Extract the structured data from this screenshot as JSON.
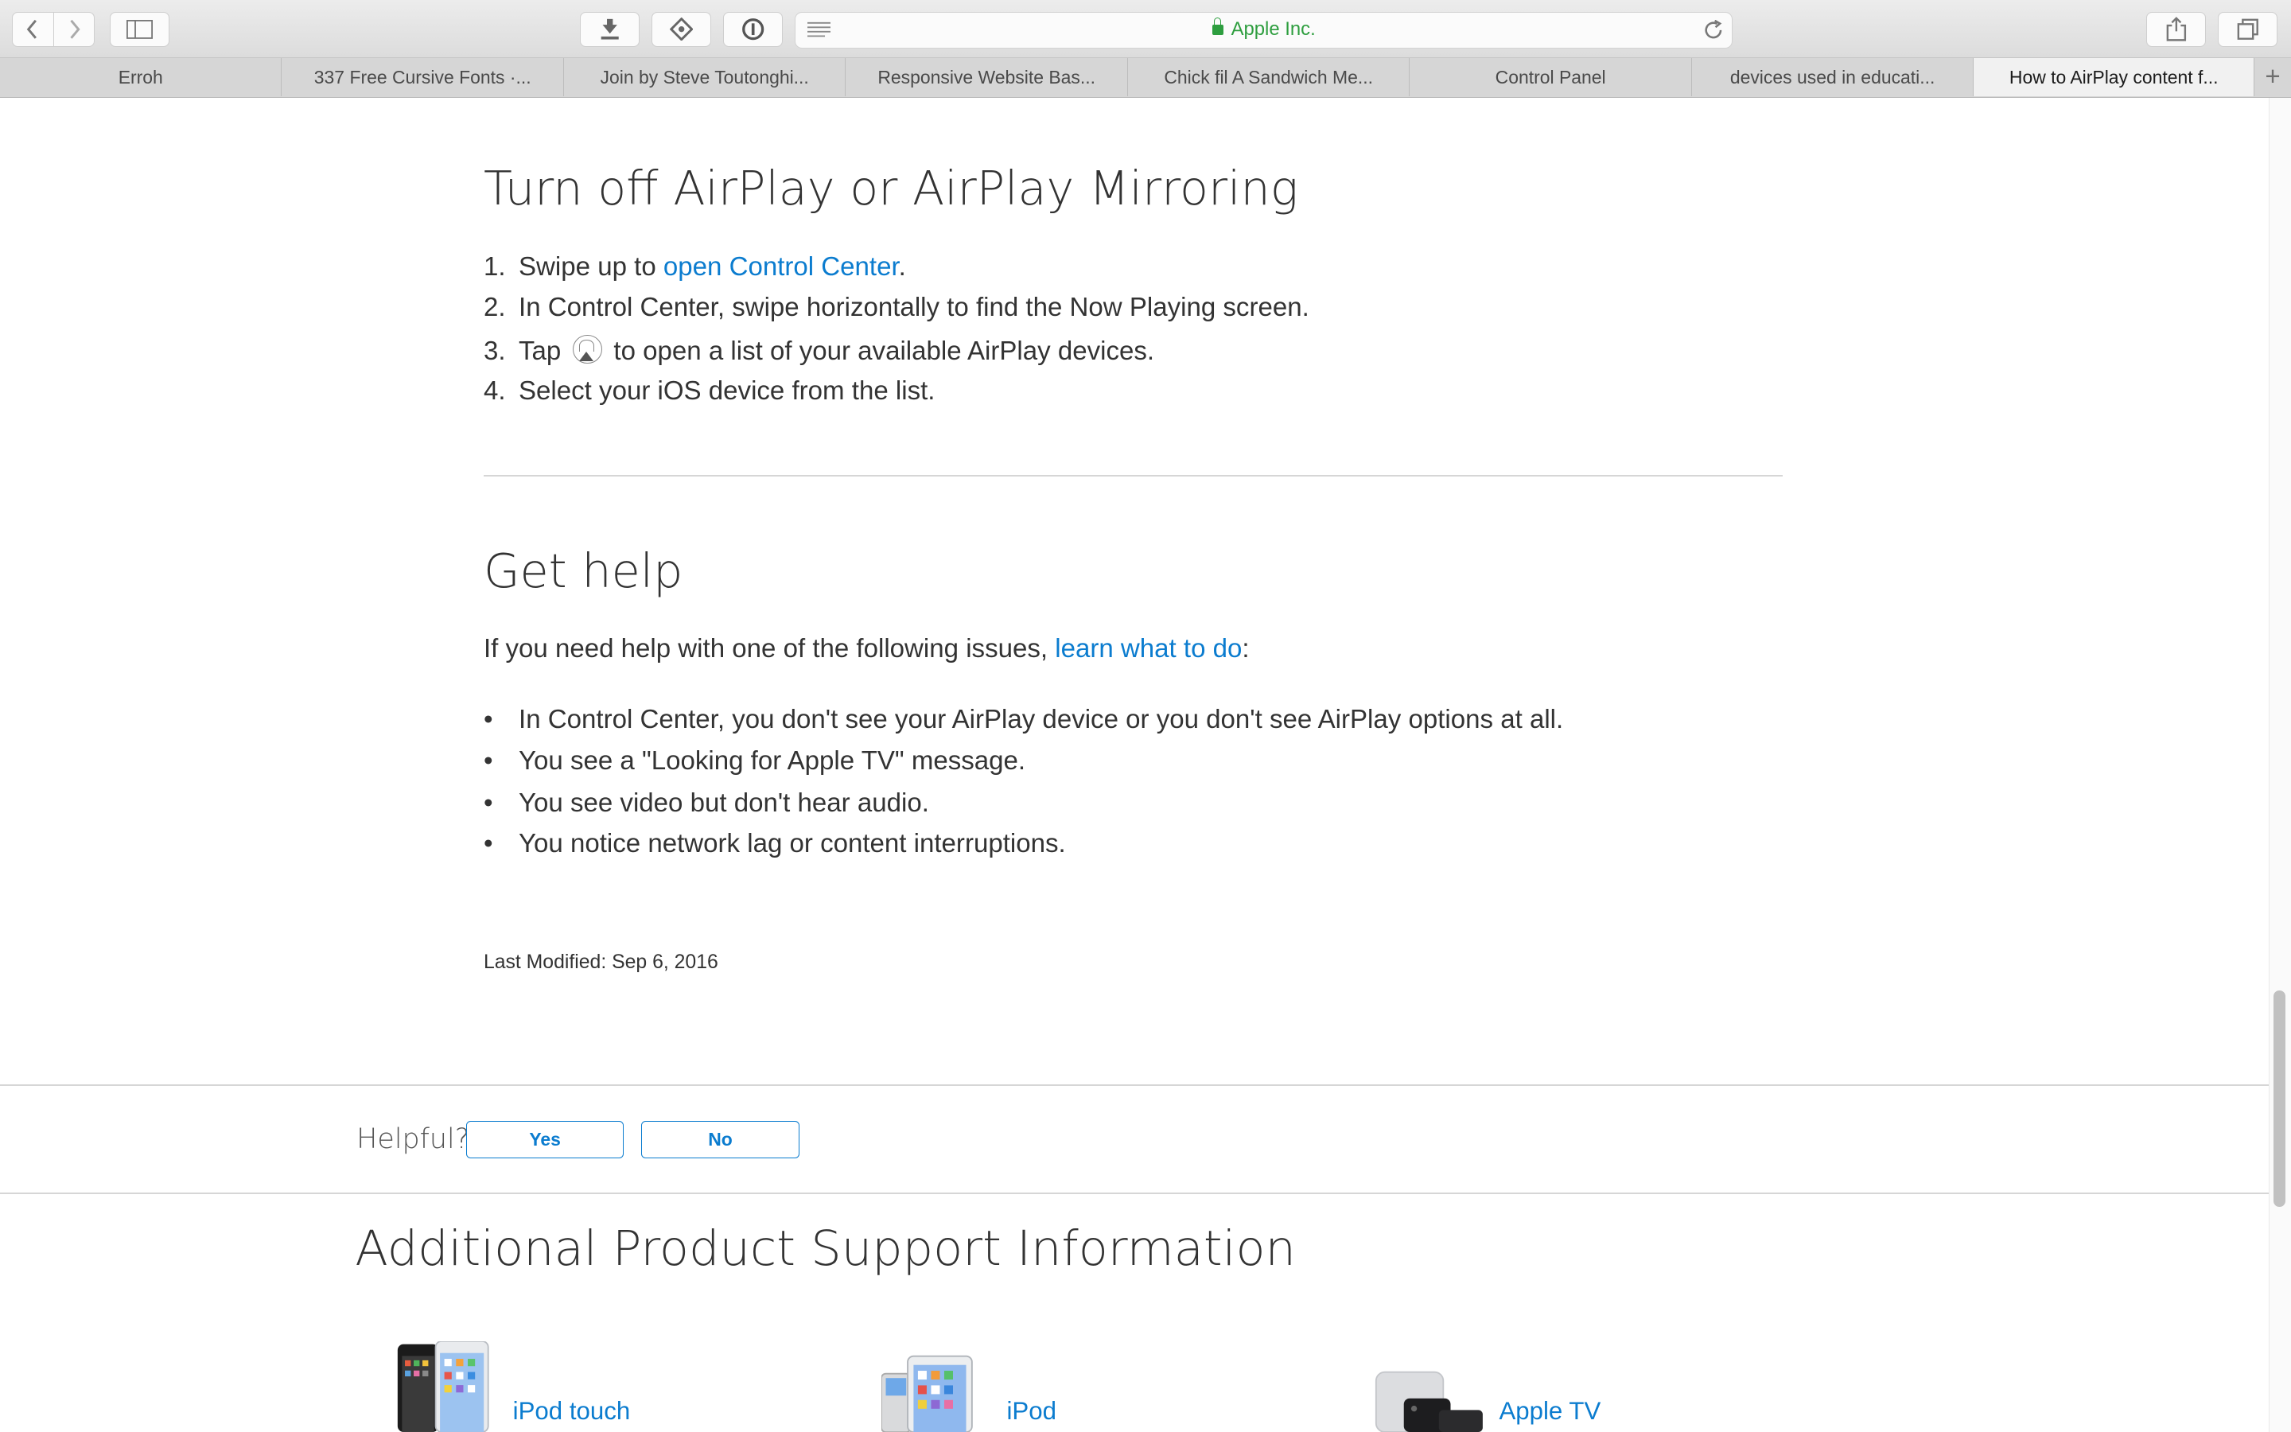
{
  "browser": {
    "site_label": "Apple Inc.",
    "tabs": [
      {
        "label": "Erroh",
        "active": false
      },
      {
        "label": "337 Free Cursive Fonts ·...",
        "active": false
      },
      {
        "label": "Join by Steve Toutonghi...",
        "active": false
      },
      {
        "label": "Responsive Website Bas...",
        "active": false
      },
      {
        "label": "Chick fil A Sandwich Me...",
        "active": false
      },
      {
        "label": "Control Panel",
        "active": false
      },
      {
        "label": "devices used in educati...",
        "active": false
      },
      {
        "label": "How to AirPlay content f...",
        "active": true
      }
    ],
    "icons": {
      "back": "chevron-left-icon",
      "forward": "chevron-right-icon",
      "sidebar": "sidebar-icon",
      "downloads": "download-icon",
      "extension": "extension-icon",
      "password": "password-icon",
      "reader": "reader-icon",
      "reload": "reload-icon",
      "share": "share-icon",
      "tabs": "tabs-overview-icon",
      "new_tab": "plus-icon"
    }
  },
  "turn_off": {
    "heading": "Turn off AirPlay or AirPlay Mirroring",
    "steps": [
      {
        "num": "1.",
        "before": "Swipe up to ",
        "link": "open Control Center",
        "after": "."
      },
      {
        "num": "2.",
        "text": "In Control Center, swipe horizontally to find the Now Playing screen."
      },
      {
        "num": "3.",
        "before": "Tap ",
        "after": " to open a list of your available AirPlay devices."
      },
      {
        "num": "4.",
        "text": "Select your iOS device from the list."
      }
    ]
  },
  "get_help": {
    "heading": "Get help",
    "intro_before": "If you need help with one of the following issues, ",
    "intro_link": "learn what to do",
    "intro_after": ":",
    "issues": [
      "In Control Center, you don't see your AirPlay device or you don't see AirPlay options at all.",
      "You see a \"Looking for Apple TV\" message.",
      "You see video but don't hear audio.",
      "You notice network lag or content interruptions."
    ]
  },
  "last_modified": "Last Modified: Sep 6, 2016",
  "feedback": {
    "question": "Helpful?",
    "yes": "Yes",
    "no": "No"
  },
  "additional": {
    "heading": "Additional Product Support Information",
    "products": [
      "iPod touch",
      "iPod",
      "Apple TV"
    ]
  },
  "colors": {
    "link": "#0b7ccf",
    "secure": "#2e9e3f",
    "text": "#333333"
  }
}
